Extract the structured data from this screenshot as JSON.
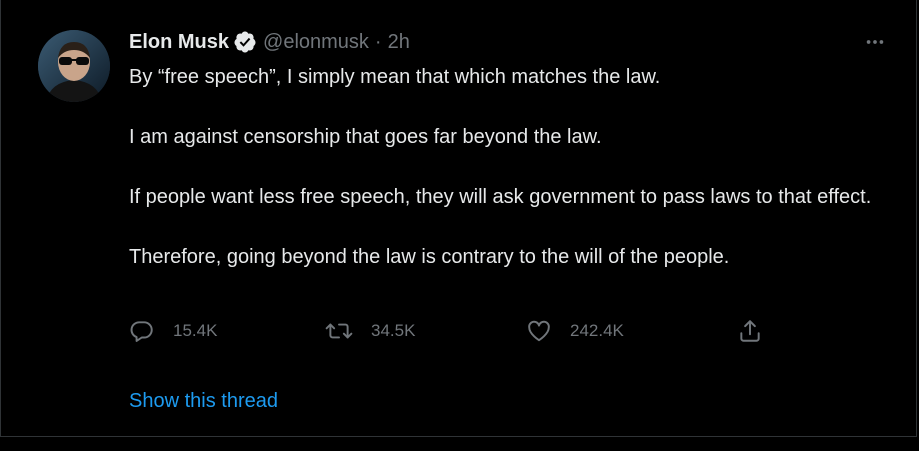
{
  "tweet": {
    "author": {
      "name": "Elon Musk",
      "handle": "@elonmusk",
      "verified_icon": "verified-badge-icon",
      "avatar_icon": "avatar"
    },
    "separator": "·",
    "time": "2h",
    "more_icon": "more-horizontal-icon",
    "paragraphs": [
      "By “free speech”, I simply mean that which matches the law.",
      "I am against censorship that goes far beyond the law.",
      "If people want less free speech, they will ask government to pass laws to that effect.",
      "Therefore, going beyond the law is contrary to the will of the people."
    ],
    "actions": {
      "reply": {
        "icon": "reply-icon",
        "count": "15.4K"
      },
      "retweet": {
        "icon": "retweet-icon",
        "count": "34.5K"
      },
      "like": {
        "icon": "heart-icon",
        "count": "242.4K"
      },
      "share": {
        "icon": "share-icon"
      }
    },
    "thread_link": "Show this thread"
  },
  "colors": {
    "background": "#000000",
    "text_primary": "#e7e9ea",
    "text_secondary": "#71767b",
    "link": "#1d9bf0",
    "border": "#2f3336"
  }
}
